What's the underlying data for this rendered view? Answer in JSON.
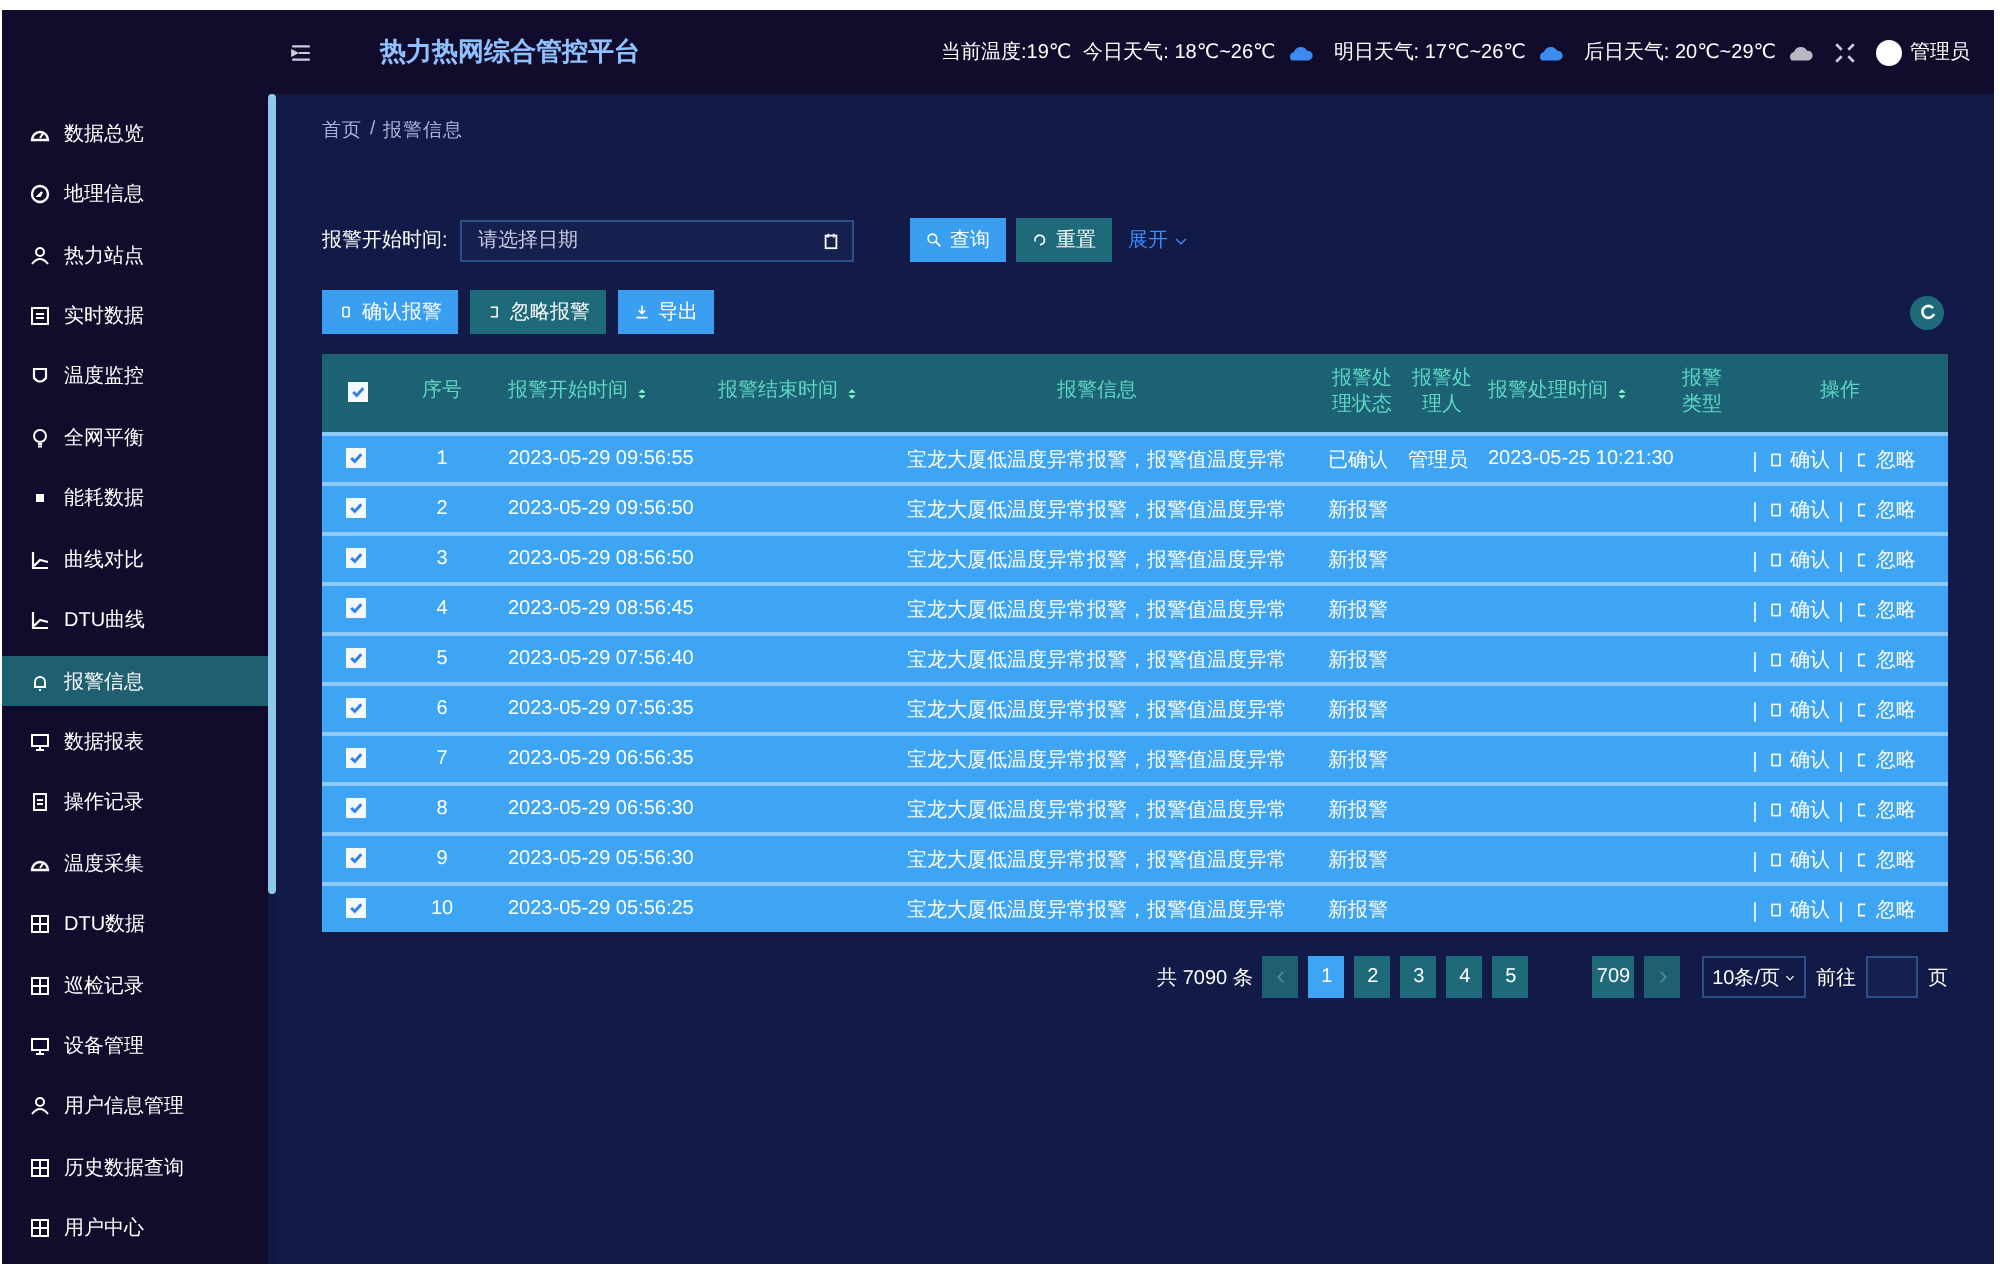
{
  "header": {
    "title": "热力热网综合管控平台",
    "current_temp": "当前温度:19℃",
    "forecasts": [
      {
        "text": "今日天气: 18℃~26℃",
        "kind": "cloud"
      },
      {
        "text": "明日天气: 17℃~26℃",
        "kind": "cloud"
      },
      {
        "text": "后日天气: 20℃~29℃",
        "kind": "overcast"
      }
    ],
    "user": "管理员"
  },
  "sidebar": {
    "items": [
      {
        "label": "数据总览",
        "selected": false
      },
      {
        "label": "地理信息",
        "selected": false
      },
      {
        "label": "热力站点",
        "selected": false
      },
      {
        "label": "实时数据",
        "selected": false
      },
      {
        "label": "温度监控",
        "selected": false
      },
      {
        "label": "全网平衡",
        "selected": false
      },
      {
        "label": "能耗数据",
        "selected": false
      },
      {
        "label": "曲线对比",
        "selected": false
      },
      {
        "label": "DTU曲线",
        "selected": false
      },
      {
        "label": "报警信息",
        "selected": true
      },
      {
        "label": "数据报表",
        "selected": false
      },
      {
        "label": "操作记录",
        "selected": false
      },
      {
        "label": "温度采集",
        "selected": false
      },
      {
        "label": "DTU数据",
        "selected": false
      },
      {
        "label": "巡检记录",
        "selected": false
      },
      {
        "label": "设备管理",
        "selected": false
      },
      {
        "label": "用户信息管理",
        "selected": false
      },
      {
        "label": "历史数据查询",
        "selected": false
      },
      {
        "label": "用户中心",
        "selected": false
      }
    ]
  },
  "breadcrumb": [
    "首页",
    "/",
    "报警信息"
  ],
  "filter": {
    "label": "报警开始时间:",
    "placeholder": "请选择日期",
    "search": "查询",
    "reset": "重置",
    "expand": "展开"
  },
  "actions": [
    {
      "label": "确认报警",
      "kind": "primary"
    },
    {
      "label": "忽略报警",
      "kind": "secondary"
    },
    {
      "label": "导出",
      "kind": "primary"
    }
  ],
  "table": {
    "all_checked": true,
    "columns": [
      {
        "label": "序号",
        "sortable": false
      },
      {
        "label": "报警开始时间",
        "sortable": true
      },
      {
        "label": "报警结束时间",
        "sortable": true
      },
      {
        "label": "报警信息",
        "sortable": false
      },
      {
        "label": "报警处理状态",
        "sortable": false
      },
      {
        "label": "报警处理人",
        "sortable": false
      },
      {
        "label": "报警处理时间",
        "sortable": true
      },
      {
        "label": "报警类型",
        "sortable": false
      },
      {
        "label": "操作",
        "sortable": false
      }
    ],
    "rows": [
      {
        "checked": true,
        "cells": [
          "1",
          "2023-05-29 09:56:55",
          "",
          "宝龙大厦低温度异常报警，报警值温度异常",
          "已确认",
          "管理员",
          "2023-05-25 10:21:30",
          ""
        ]
      },
      {
        "checked": true,
        "cells": [
          "2",
          "2023-05-29 09:56:50",
          "",
          "宝龙大厦低温度异常报警，报警值温度异常",
          "新报警",
          "",
          "",
          ""
        ]
      },
      {
        "checked": true,
        "cells": [
          "3",
          "2023-05-29 08:56:50",
          "",
          "宝龙大厦低温度异常报警，报警值温度异常",
          "新报警",
          "",
          "",
          ""
        ]
      },
      {
        "checked": true,
        "cells": [
          "4",
          "2023-05-29 08:56:45",
          "",
          "宝龙大厦低温度异常报警，报警值温度异常",
          "新报警",
          "",
          "",
          ""
        ]
      },
      {
        "checked": true,
        "cells": [
          "5",
          "2023-05-29 07:56:40",
          "",
          "宝龙大厦低温度异常报警，报警值温度异常",
          "新报警",
          "",
          "",
          ""
        ]
      },
      {
        "checked": true,
        "cells": [
          "6",
          "2023-05-29 07:56:35",
          "",
          "宝龙大厦低温度异常报警，报警值温度异常",
          "新报警",
          "",
          "",
          ""
        ]
      },
      {
        "checked": true,
        "cells": [
          "7",
          "2023-05-29 06:56:35",
          "",
          "宝龙大厦低温度异常报警，报警值温度异常",
          "新报警",
          "",
          "",
          ""
        ]
      },
      {
        "checked": true,
        "cells": [
          "8",
          "2023-05-29 06:56:30",
          "",
          "宝龙大厦低温度异常报警，报警值温度异常",
          "新报警",
          "",
          "",
          ""
        ]
      },
      {
        "checked": true,
        "cells": [
          "9",
          "2023-05-29 05:56:30",
          "",
          "宝龙大厦低温度异常报警，报警值温度异常",
          "新报警",
          "",
          "",
          ""
        ]
      },
      {
        "checked": true,
        "cells": [
          "10",
          "2023-05-29 05:56:25",
          "",
          "宝龙大厦低温度异常报警，报警值温度异常",
          "新报警",
          "",
          "",
          ""
        ]
      }
    ],
    "row_actions": [
      [
        "确认",
        "忽略"
      ],
      [
        "确认",
        "忽略"
      ],
      [
        "确认",
        "忽略"
      ],
      [
        "确认",
        "忽略"
      ],
      [
        "确认",
        "忽略"
      ],
      [
        "确认",
        "忽略"
      ],
      [
        "确认",
        "忽略"
      ],
      [
        "确认",
        "忽略"
      ],
      [
        "确认",
        "忽略"
      ],
      [
        "确认",
        "忽略"
      ]
    ]
  },
  "pagination": {
    "total": "共 7090 条",
    "pages": [
      {
        "label": "1",
        "selected": true
      },
      {
        "label": "2",
        "selected": false
      },
      {
        "label": "3",
        "selected": false
      },
      {
        "label": "4",
        "selected": false
      },
      {
        "label": "5",
        "selected": false
      },
      {
        "label": "709",
        "selected": false
      }
    ],
    "page_size": "10条/页",
    "goto": "前往",
    "page_unit": "页"
  }
}
